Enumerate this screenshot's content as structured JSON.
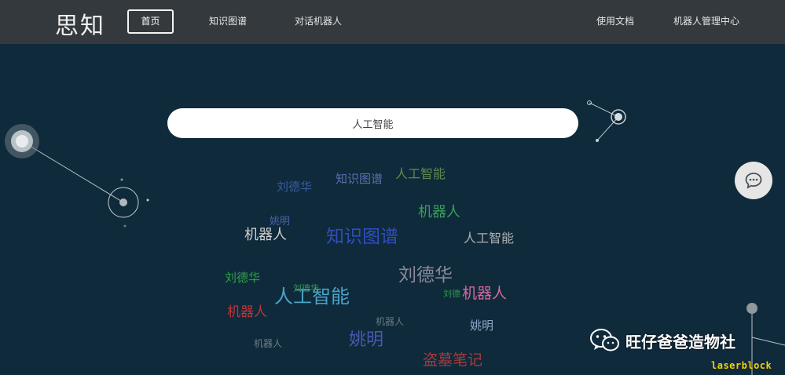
{
  "header": {
    "logo": "思知",
    "nav": [
      {
        "label": "首页",
        "active": true
      },
      {
        "label": "知识图谱"
      },
      {
        "label": "对话机器人"
      }
    ],
    "right_nav": [
      {
        "label": "使用文档"
      },
      {
        "label": "机器人管理中心"
      }
    ]
  },
  "search": {
    "value": "人工智能"
  },
  "chat_button": {
    "icon": "chat-bubble-icon"
  },
  "word_cloud": [
    {
      "text": "刘德华",
      "color": "#3a5ba3"
    },
    {
      "text": "知识图谱",
      "color": "#5a6fae"
    },
    {
      "text": "人工智能",
      "color": "#5f8a4e"
    },
    {
      "text": "姚明",
      "color": "#4a5fa8"
    },
    {
      "text": "机器人",
      "color": "#3aa05a"
    },
    {
      "text": "机器人",
      "color": "#d0d0d0"
    },
    {
      "text": "知识图谱",
      "color": "#2f4ec0"
    },
    {
      "text": "人工智能",
      "color": "#b0b0b0"
    },
    {
      "text": "刘德华",
      "color": "#2fa24a"
    },
    {
      "text": "刘德华",
      "color": "#8a8a9a"
    },
    {
      "text": "人工智能",
      "color": "#4aa3c9"
    },
    {
      "text": "机器人",
      "color": "#d46aa0"
    },
    {
      "text": "机器人",
      "color": "#c0353b"
    },
    {
      "text": "姚明",
      "color": "#8fa8c8"
    },
    {
      "text": "机器人",
      "color": "#6a7a7a"
    },
    {
      "text": "姚明",
      "color": "#4a58b0"
    },
    {
      "text": "机器人",
      "color": "#6f7f85"
    },
    {
      "text": "盗墓笔记",
      "color": "#a83a3a"
    },
    {
      "text": "刘德华",
      "color": "#2e9a4f"
    },
    {
      "text": "刘德",
      "color": "#2e9a4f"
    }
  ],
  "watermark": {
    "text": "旺仔爸爸造物社",
    "icon": "wechat-icon"
  },
  "brand_tag": {
    "text": "laserblock",
    "color": "#f7d000"
  }
}
